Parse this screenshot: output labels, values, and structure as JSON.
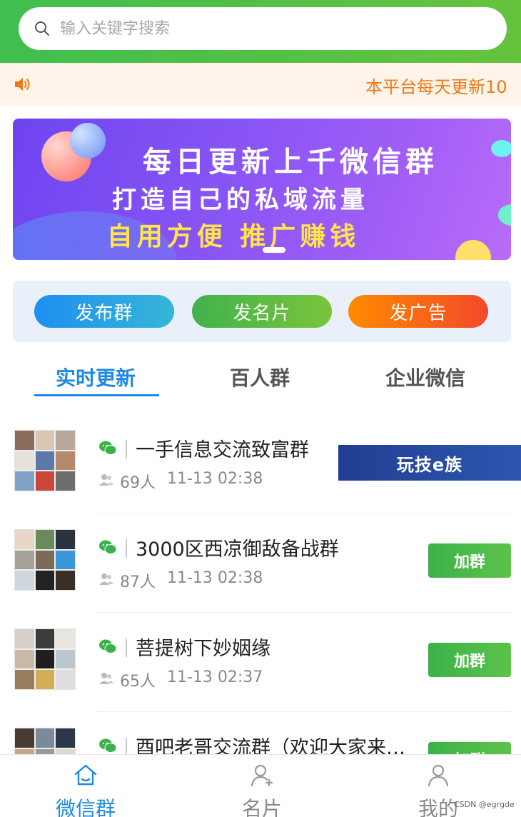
{
  "search": {
    "placeholder": "输入关键字搜索"
  },
  "notice": {
    "text": "本平台每天更新10"
  },
  "banner": {
    "line1": "每日更新上千微信群",
    "line2": "打造自己的私域流量",
    "line3": "自用方便 推广赚钱"
  },
  "actions": [
    {
      "label": "发布群"
    },
    {
      "label": "发名片"
    },
    {
      "label": "发广告"
    }
  ],
  "tabs": [
    {
      "label": "实时更新",
      "active": true
    },
    {
      "label": "百人群",
      "active": false
    },
    {
      "label": "企业微信",
      "active": false
    }
  ],
  "groups": [
    {
      "name": "一手信息交流致富群",
      "people": "69人",
      "time": "11-13 02:38",
      "ad_label": "玩技e族"
    },
    {
      "name": "3000区西凉御敌备战群",
      "people": "87人",
      "time": "11-13 02:38",
      "join_label": "加群"
    },
    {
      "name": "菩提树下妙姻缘",
      "people": "65人",
      "time": "11-13 02:37",
      "join_label": "加群"
    },
    {
      "name": "酉吧老哥交流群（欢迎大家来…",
      "people": "",
      "time": "",
      "join_label": "加群"
    }
  ],
  "bottom_nav": [
    {
      "label": "微信群",
      "icon": "home-icon",
      "active": true
    },
    {
      "label": "名片",
      "icon": "add-user-icon",
      "active": false
    },
    {
      "label": "我的",
      "icon": "user-icon",
      "active": false
    }
  ],
  "watermark": "CSDN @egrgde",
  "colors": {
    "brand_green": "#3fbf4f",
    "accent_blue": "#1e88e5",
    "notice_orange": "#f07a1a",
    "join_green": "#3cb149"
  }
}
